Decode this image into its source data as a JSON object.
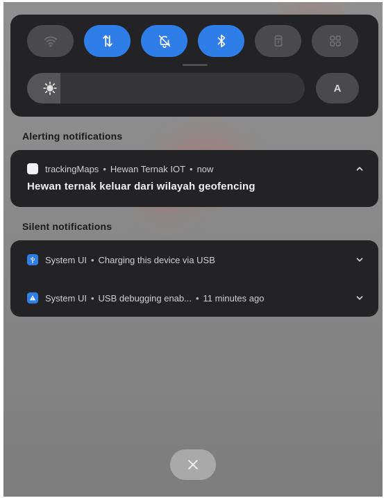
{
  "quick_settings": {
    "tiles": [
      {
        "icon": "wifi-icon",
        "active": false
      },
      {
        "icon": "mobile-data-icon",
        "active": true
      },
      {
        "icon": "silent-bell-icon",
        "active": true
      },
      {
        "icon": "bluetooth-icon",
        "active": true
      },
      {
        "icon": "flashlight-icon",
        "active": false
      },
      {
        "icon": "grid-icon",
        "active": false
      }
    ],
    "brightness_level": 0.12,
    "auto_brightness_label": "A"
  },
  "alerting": {
    "section_title": "Alerting notifications",
    "notification": {
      "app": "trackingMaps",
      "channel": "Hewan Ternak IOT",
      "time": "now",
      "title": "Hewan ternak keluar dari wilayah geofencing"
    }
  },
  "silent": {
    "section_title": "Silent notifications",
    "notifications": [
      {
        "app": "System UI",
        "text": "Charging this device via USB",
        "time": ""
      },
      {
        "app": "System UI",
        "text": "USB debugging enab...",
        "time": "11 minutes ago"
      }
    ]
  },
  "colors": {
    "accent": "#2f7de6",
    "panel": "#232325"
  }
}
